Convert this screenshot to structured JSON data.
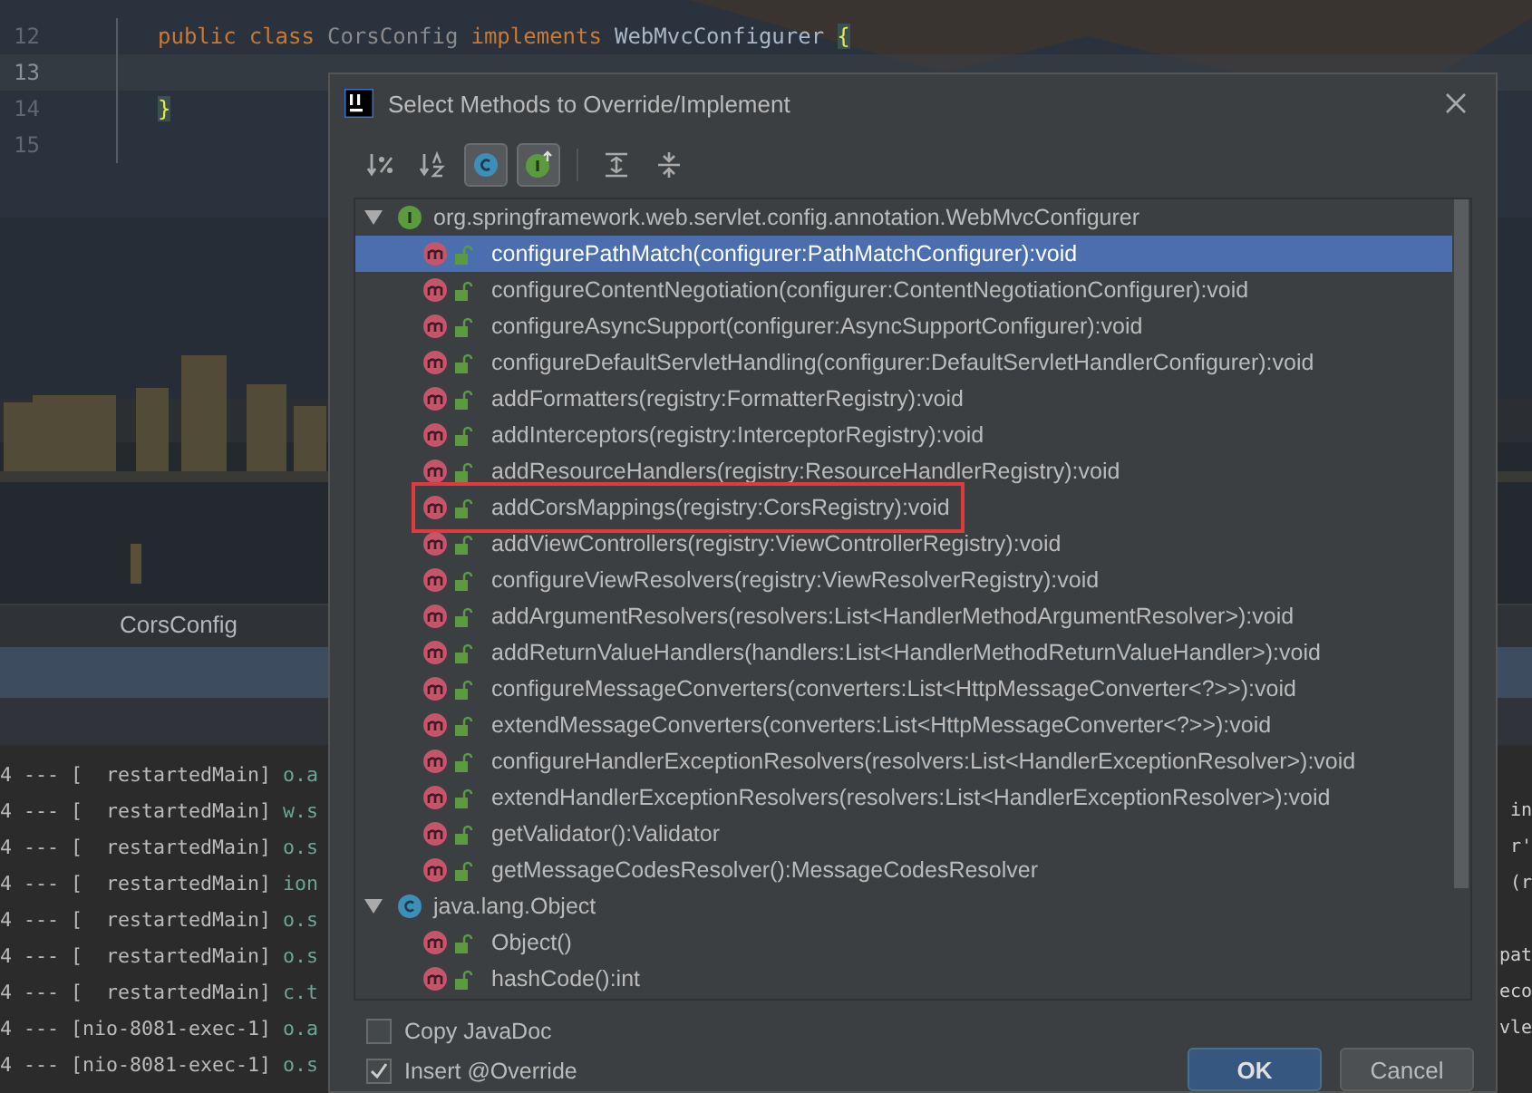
{
  "editor": {
    "lines": [
      {
        "number": "12",
        "current": false,
        "tokens": [
          {
            "text": "public",
            "kind": "keyword"
          },
          {
            "text": "class",
            "kind": "keyword"
          },
          {
            "text": "CorsConfig",
            "kind": "unused"
          },
          {
            "text": "implements",
            "kind": "keyword"
          },
          {
            "text": "WebMvcConfigurer",
            "kind": "type"
          },
          {
            "text": "{",
            "kind": "brace"
          }
        ]
      },
      {
        "number": "13",
        "current": true
      },
      {
        "number": "14",
        "current": false,
        "tokens": [
          {
            "text": "}",
            "kind": "brace"
          }
        ]
      },
      {
        "number": "15",
        "current": false
      }
    ]
  },
  "editor_tab": {
    "label": "CorsConfig"
  },
  "console": {
    "rows": [
      {
        "left": "4 --- [  restartedMain]",
        "logger": "o.a",
        "right": ""
      },
      {
        "left": "4 --- [  restartedMain]",
        "logger": "w.s",
        "right": "in"
      },
      {
        "left": "4 --- [  restartedMain]",
        "logger": "o.s",
        "right": "r'"
      },
      {
        "left": "4 --- [  restartedMain]",
        "logger": "ion",
        "right": "(r"
      },
      {
        "left": "4 --- [  restartedMain]",
        "logger": "o.s",
        "right": ""
      },
      {
        "left": "4 --- [  restartedMain]",
        "logger": "o.s",
        "right": "pat"
      },
      {
        "left": "4 --- [  restartedMain]",
        "logger": "c.t",
        "right": "eco"
      },
      {
        "left": "4 --- [nio-8081-exec-1]",
        "logger": "o.a",
        "right": "vle"
      },
      {
        "left": "4 --- [nio-8081-exec-1]",
        "logger": "o.s",
        "right": ""
      }
    ]
  },
  "dialog": {
    "title": "Select Methods to Override/Implement",
    "toolbar": [
      {
        "kind": "sort-visibility",
        "selected": false
      },
      {
        "kind": "sort-alpha",
        "selected": false
      },
      {
        "kind": "show-classes",
        "selected": true
      },
      {
        "kind": "show-interfaces",
        "selected": true
      },
      {
        "kind": "separator"
      },
      {
        "kind": "expand-all",
        "selected": false
      },
      {
        "kind": "collapse-all",
        "selected": false
      }
    ],
    "tree": [
      {
        "label": "org.springframework.web.servlet.config.annotation.WebMvcConfigurer",
        "kind": "interface",
        "expanded": true,
        "children": [
          {
            "label": "configurePathMatch(configurer:PathMatchConfigurer):void",
            "selected": true,
            "boxed": false
          },
          {
            "label": "configureContentNegotiation(configurer:ContentNegotiationConfigurer):void",
            "selected": false,
            "boxed": false
          },
          {
            "label": "configureAsyncSupport(configurer:AsyncSupportConfigurer):void",
            "selected": false,
            "boxed": false
          },
          {
            "label": "configureDefaultServletHandling(configurer:DefaultServletHandlerConfigurer):void",
            "selected": false,
            "boxed": false
          },
          {
            "label": "addFormatters(registry:FormatterRegistry):void",
            "selected": false,
            "boxed": false
          },
          {
            "label": "addInterceptors(registry:InterceptorRegistry):void",
            "selected": false,
            "boxed": false
          },
          {
            "label": "addResourceHandlers(registry:ResourceHandlerRegistry):void",
            "selected": false,
            "boxed": false
          },
          {
            "label": "addCorsMappings(registry:CorsRegistry):void",
            "selected": false,
            "boxed": true
          },
          {
            "label": "addViewControllers(registry:ViewControllerRegistry):void",
            "selected": false,
            "boxed": false
          },
          {
            "label": "configureViewResolvers(registry:ViewResolverRegistry):void",
            "selected": false,
            "boxed": false
          },
          {
            "label": "addArgumentResolvers(resolvers:List<HandlerMethodArgumentResolver>):void",
            "selected": false,
            "boxed": false
          },
          {
            "label": "addReturnValueHandlers(handlers:List<HandlerMethodReturnValueHandler>):void",
            "selected": false,
            "boxed": false
          },
          {
            "label": "configureMessageConverters(converters:List<HttpMessageConverter<?>>):void",
            "selected": false,
            "boxed": false
          },
          {
            "label": "extendMessageConverters(converters:List<HttpMessageConverter<?>>):void",
            "selected": false,
            "boxed": false
          },
          {
            "label": "configureHandlerExceptionResolvers(resolvers:List<HandlerExceptionResolver>):void",
            "selected": false,
            "boxed": false
          },
          {
            "label": "extendHandlerExceptionResolvers(resolvers:List<HandlerExceptionResolver>):void",
            "selected": false,
            "boxed": false
          },
          {
            "label": "getValidator():Validator",
            "selected": false,
            "boxed": false
          },
          {
            "label": "getMessageCodesResolver():MessageCodesResolver",
            "selected": false,
            "boxed": false
          }
        ]
      },
      {
        "label": "java.lang.Object",
        "kind": "class",
        "expanded": true,
        "children": [
          {
            "label": "Object()",
            "selected": false,
            "boxed": false
          },
          {
            "label": "hashCode():int",
            "selected": false,
            "boxed": false
          }
        ]
      }
    ],
    "options": [
      {
        "label": "Copy JavaDoc",
        "checked": false
      },
      {
        "label": "Insert @Override",
        "checked": true
      }
    ],
    "buttons": [
      {
        "label": "OK",
        "kind": "default"
      },
      {
        "label": "Cancel",
        "kind": "normal"
      }
    ]
  }
}
